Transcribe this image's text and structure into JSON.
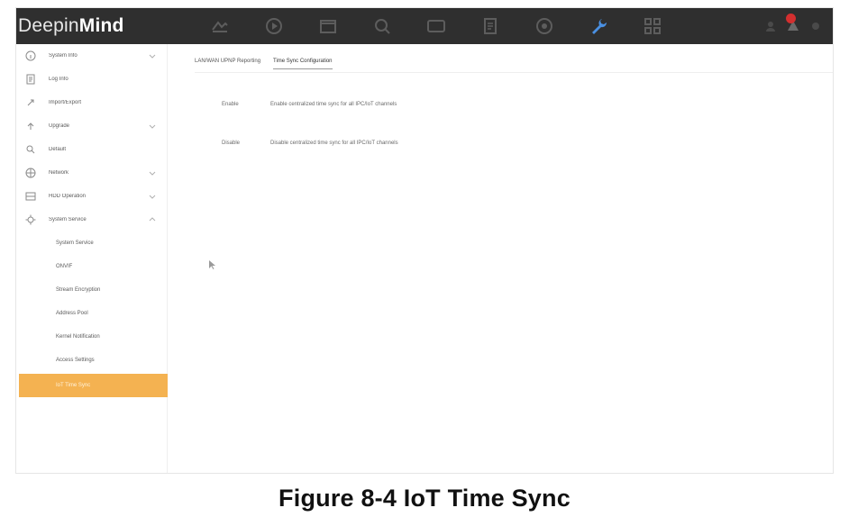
{
  "app": {
    "brand_regular": "Deepin",
    "brand_bold": "Mind"
  },
  "topbar": {
    "icons": [
      "live-view-icon",
      "playback-icon",
      "file-management-icon",
      "search-icon",
      "display-icon",
      "log-icon",
      "smart-icon",
      "maintenance-icon",
      "system-icon"
    ],
    "active_icon": "maintenance-icon",
    "active_color": "#4a90e2"
  },
  "sidebar": {
    "items": [
      {
        "label": "System Info",
        "icon": "info-icon",
        "expandable": true
      },
      {
        "label": "Log Info",
        "icon": "log-info-icon",
        "expandable": false
      },
      {
        "label": "Import/Export",
        "icon": "import-export-icon",
        "expandable": false
      },
      {
        "label": "Upgrade",
        "icon": "upgrade-icon",
        "expandable": true
      },
      {
        "label": "Default",
        "icon": "default-icon",
        "expandable": false
      },
      {
        "label": "Network",
        "icon": "network-icon",
        "expandable": true
      },
      {
        "label": "HDD Operation",
        "icon": "hdd-icon",
        "expandable": true
      },
      {
        "label": "System Service",
        "icon": "service-icon",
        "expandable": true
      }
    ],
    "submenu": [
      {
        "label": "System Service",
        "active": false
      },
      {
        "label": "ONVIF",
        "active": false
      },
      {
        "label": "Stream Encryption",
        "active": false
      },
      {
        "label": "Address Pool",
        "active": false
      },
      {
        "label": "Kernel Notification",
        "active": false
      },
      {
        "label": "Access Settings",
        "active": false
      },
      {
        "label": "IoT Time Sync",
        "active": true
      }
    ],
    "active_color": "#f4b251"
  },
  "content": {
    "tabs": [
      {
        "label": "LAN/WAN UPNP Reporting",
        "active": false
      },
      {
        "label": "Time Sync Configuration",
        "active": true
      }
    ],
    "options": [
      {
        "label": "Enable",
        "description": "Enable centralized time sync for all IPC/IoT channels"
      },
      {
        "label": "Disable",
        "description": "Disable centralized time sync for all IPC/IoT channels"
      }
    ]
  },
  "caption": "Figure 8-4 IoT Time Sync"
}
